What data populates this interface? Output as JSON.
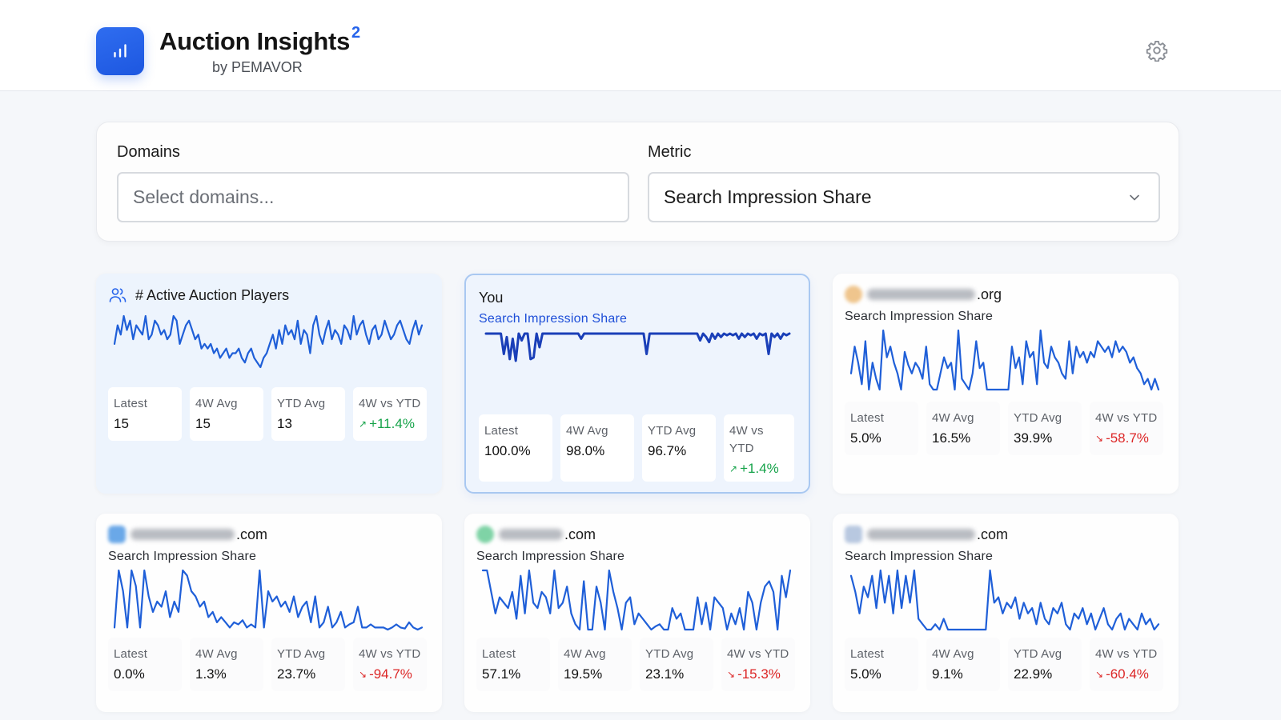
{
  "header": {
    "app_title": "Auction Insights",
    "title_superscript": "2",
    "subtitle": "by PEMAVOR",
    "logo_icon": "bar-chart-icon",
    "settings_icon": "gear-icon"
  },
  "filters": {
    "domains": {
      "label": "Domains",
      "placeholder": "Select domains...",
      "value": ""
    },
    "metric": {
      "label": "Metric",
      "selected": "Search Impression Share",
      "icon": "chevron-down-icon"
    }
  },
  "colors": {
    "accent": "#2563eb",
    "line": "#1f5fd8",
    "positive": "#16a34a",
    "negative": "#dc2626"
  },
  "stat_labels": {
    "latest": "Latest",
    "avg4w": "4W Avg",
    "ytd": "YTD Avg",
    "delta": "4W vs YTD"
  },
  "cards": [
    {
      "title": "# Active Auction Players",
      "icon": "users-icon",
      "subtitle": "",
      "latest": "15",
      "avg4w": "15",
      "ytd": "13",
      "delta": "+11.4%",
      "trend": "up",
      "series": [
        6,
        10,
        8,
        12,
        9,
        11,
        7,
        10,
        9,
        8,
        12,
        7,
        8,
        11,
        10,
        8,
        9,
        7,
        8,
        12,
        11,
        6,
        8,
        10,
        11,
        9,
        7,
        8,
        5,
        6,
        5,
        6,
        4,
        5,
        3,
        4,
        5,
        3,
        4,
        4,
        5,
        3,
        2,
        4,
        5,
        3,
        2,
        1,
        3,
        4,
        6,
        8,
        5,
        9,
        6,
        10,
        8,
        9,
        7,
        11,
        6,
        9,
        8,
        4,
        10,
        12,
        8,
        6,
        9,
        11,
        7,
        9,
        8,
        6,
        10,
        9,
        7,
        12,
        8,
        10,
        11,
        8,
        6,
        9,
        10,
        7,
        8,
        11,
        9,
        7,
        8,
        10,
        11,
        9,
        7,
        6,
        9,
        11,
        8,
        10
      ]
    },
    {
      "title": "You",
      "icon": "",
      "subtitle": "Search Impression Share",
      "latest": "100.0%",
      "avg4w": "98.0%",
      "ytd": "96.7%",
      "delta": "+1.4%",
      "trend": "up",
      "series": [
        100,
        100,
        100,
        100,
        100,
        100,
        88,
        98,
        85,
        97,
        84,
        100,
        96,
        100,
        100,
        85,
        86,
        100,
        92,
        100,
        100,
        100,
        100,
        100,
        100,
        100,
        100,
        100,
        100,
        100,
        100,
        100,
        97,
        100,
        100,
        100,
        100,
        100,
        100,
        100,
        100,
        100,
        100,
        100,
        100,
        100,
        100,
        100,
        100,
        100,
        100,
        100,
        100,
        100,
        88,
        100,
        100,
        100,
        100,
        100,
        100,
        100,
        100,
        100,
        100,
        100,
        100,
        100,
        100,
        100,
        100,
        100,
        96,
        100,
        98,
        95,
        100,
        97,
        100,
        98,
        100,
        99,
        100,
        99,
        100,
        97,
        100,
        98,
        100,
        99,
        100,
        97,
        100,
        99,
        100,
        88,
        100,
        98,
        100,
        97,
        100,
        99,
        100
      ]
    },
    {
      "title_suffix": ".org",
      "favicon_color": "#efc58d",
      "blur_width": 135,
      "subtitle": "Search Impression Share",
      "latest": "5.0%",
      "avg4w": "16.5%",
      "ytd": "39.9%",
      "delta": "-58.7%",
      "trend": "down",
      "series": [
        20,
        45,
        30,
        10,
        50,
        5,
        30,
        15,
        5,
        60,
        35,
        45,
        30,
        20,
        5,
        40,
        28,
        20,
        30,
        25,
        15,
        45,
        10,
        5,
        5,
        20,
        35,
        25,
        30,
        5,
        60,
        15,
        10,
        5,
        20,
        50,
        25,
        30,
        5,
        5,
        5,
        5,
        5,
        5,
        5,
        45,
        25,
        35,
        10,
        50,
        35,
        40,
        10,
        60,
        30,
        25,
        45,
        35,
        30,
        20,
        15,
        50,
        20,
        45,
        35,
        40,
        30,
        40,
        35,
        50,
        45,
        40,
        45,
        35,
        50,
        40,
        45,
        40,
        30,
        35,
        25,
        20,
        10,
        15,
        5,
        15,
        5
      ]
    },
    {
      "title_suffix": ".com",
      "favicon_color": "#6aa8e8",
      "blur_width": 130,
      "subtitle": "Search Impression Share",
      "latest": "0.0%",
      "avg4w": "1.3%",
      "ytd": "23.7%",
      "delta": "-94.7%",
      "trend": "down",
      "series": [
        5,
        60,
        40,
        5,
        60,
        45,
        5,
        60,
        35,
        20,
        30,
        25,
        40,
        15,
        30,
        20,
        60,
        55,
        40,
        35,
        25,
        30,
        15,
        20,
        10,
        15,
        10,
        5,
        10,
        8,
        12,
        5,
        8,
        5,
        60,
        5,
        40,
        30,
        35,
        25,
        30,
        20,
        35,
        15,
        25,
        30,
        10,
        35,
        5,
        10,
        25,
        5,
        10,
        20,
        5,
        8,
        10,
        25,
        5,
        5,
        8,
        5,
        5,
        5,
        3,
        5,
        8,
        5,
        4,
        10,
        5,
        3,
        5
      ]
    },
    {
      "title_suffix": ".com",
      "favicon_color": "#7fd3a6",
      "blur_width": 80,
      "subtitle": "Search Impression Share",
      "latest": "57.1%",
      "avg4w": "19.5%",
      "ytd": "23.1%",
      "delta": "-15.3%",
      "trend": "down",
      "series": [
        60,
        60,
        40,
        20,
        35,
        30,
        25,
        40,
        15,
        55,
        20,
        60,
        30,
        25,
        40,
        35,
        20,
        60,
        25,
        30,
        45,
        20,
        10,
        5,
        50,
        5,
        5,
        45,
        30,
        5,
        60,
        40,
        25,
        5,
        30,
        35,
        10,
        20,
        15,
        10,
        5,
        8,
        10,
        5,
        5,
        25,
        15,
        20,
        5,
        5,
        5,
        35,
        10,
        30,
        5,
        35,
        30,
        25,
        5,
        20,
        10,
        25,
        5,
        40,
        30,
        5,
        30,
        45,
        50,
        40,
        5,
        55,
        35,
        60
      ]
    },
    {
      "title_suffix": ".com",
      "favicon_color": "#b8c8e0",
      "blur_width": 135,
      "subtitle": "Search Impression Share",
      "latest": "5.0%",
      "avg4w": "9.1%",
      "ytd": "22.9%",
      "delta": "-60.4%",
      "trend": "down",
      "series": [
        55,
        40,
        20,
        45,
        35,
        55,
        25,
        60,
        30,
        55,
        20,
        60,
        25,
        55,
        30,
        60,
        15,
        10,
        5,
        5,
        10,
        5,
        15,
        5,
        5,
        5,
        5,
        5,
        5,
        5,
        5,
        5,
        5,
        60,
        30,
        35,
        20,
        30,
        25,
        35,
        15,
        30,
        20,
        25,
        10,
        30,
        15,
        10,
        25,
        20,
        30,
        10,
        5,
        20,
        15,
        25,
        10,
        20,
        5,
        15,
        25,
        10,
        5,
        15,
        20,
        5,
        15,
        10,
        5,
        20,
        10,
        15,
        5,
        10
      ]
    }
  ]
}
